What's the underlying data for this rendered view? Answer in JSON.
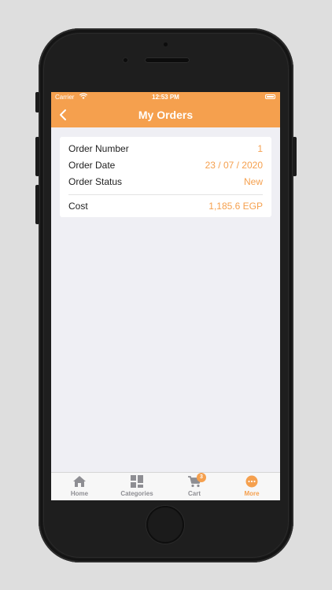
{
  "statusbar": {
    "carrier": "Carrier",
    "time": "12:53 PM"
  },
  "navbar": {
    "title": "My Orders"
  },
  "order": {
    "number_label": "Order Number",
    "number_value": "1",
    "date_label": "Order Date",
    "date_value": "23 / 07 / 2020",
    "status_label": "Order Status",
    "status_value": "New",
    "cost_label": "Cost",
    "cost_value": "1,185.6 EGP"
  },
  "tabbar": {
    "items": [
      {
        "label": "Home",
        "icon": "home-icon"
      },
      {
        "label": "Categories",
        "icon": "categories-icon"
      },
      {
        "label": "Cart",
        "icon": "cart-icon",
        "badge": "3"
      },
      {
        "label": "More",
        "icon": "more-icon",
        "active": true
      }
    ]
  },
  "colors": {
    "accent": "#f5a04e",
    "background": "#efeff4",
    "tab_inactive": "#8e8e93"
  }
}
